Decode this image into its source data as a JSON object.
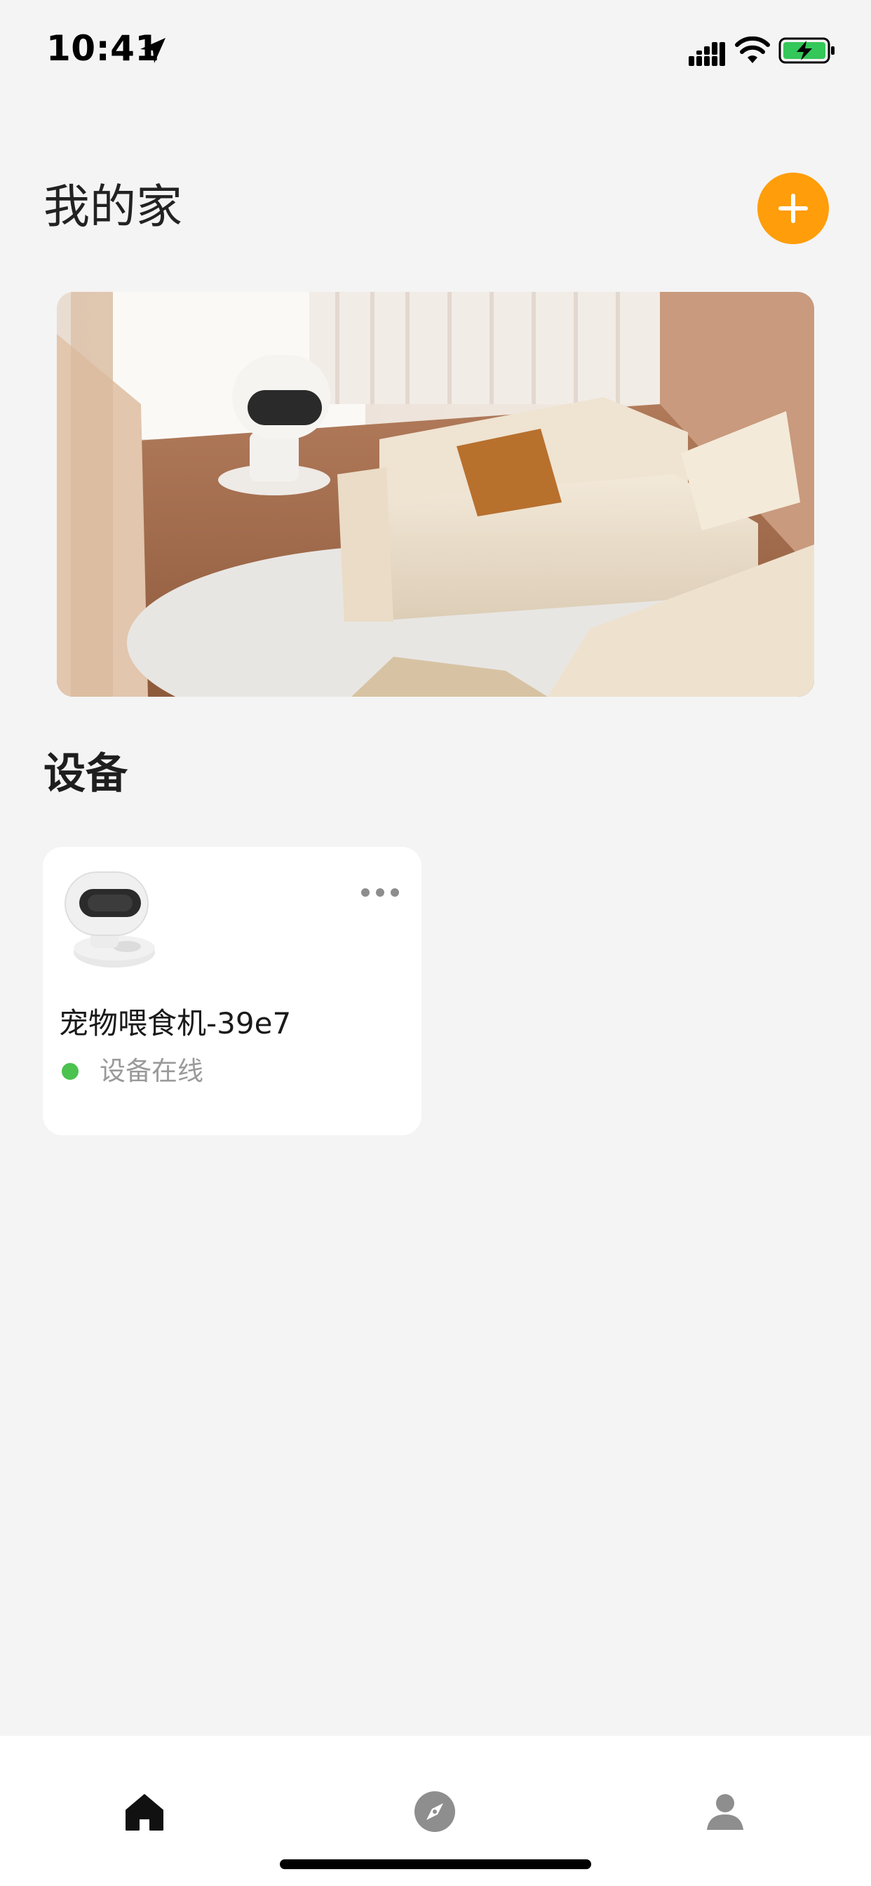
{
  "status_bar": {
    "time": "10:41",
    "icons": [
      "location-arrow-icon",
      "signal-icon",
      "wifi-icon",
      "battery-charging-icon"
    ]
  },
  "header": {
    "title": "我的家",
    "add_button_icon": "plus-icon",
    "accent_color": "#ff9d0a"
  },
  "banner": {
    "image": "living-room-with-pet-feeder"
  },
  "devices_section": {
    "title": "设备",
    "devices": [
      {
        "name": "宠物喂食机-39e7",
        "status": "设备在线",
        "status_color": "#4cc24f",
        "icon": "pet-feeder-icon",
        "more_icon": "more-dots-icon"
      }
    ]
  },
  "tab_bar": {
    "tabs": [
      {
        "icon": "home-icon",
        "active": true
      },
      {
        "icon": "compass-icon",
        "active": false
      },
      {
        "icon": "person-icon",
        "active": false
      }
    ]
  }
}
